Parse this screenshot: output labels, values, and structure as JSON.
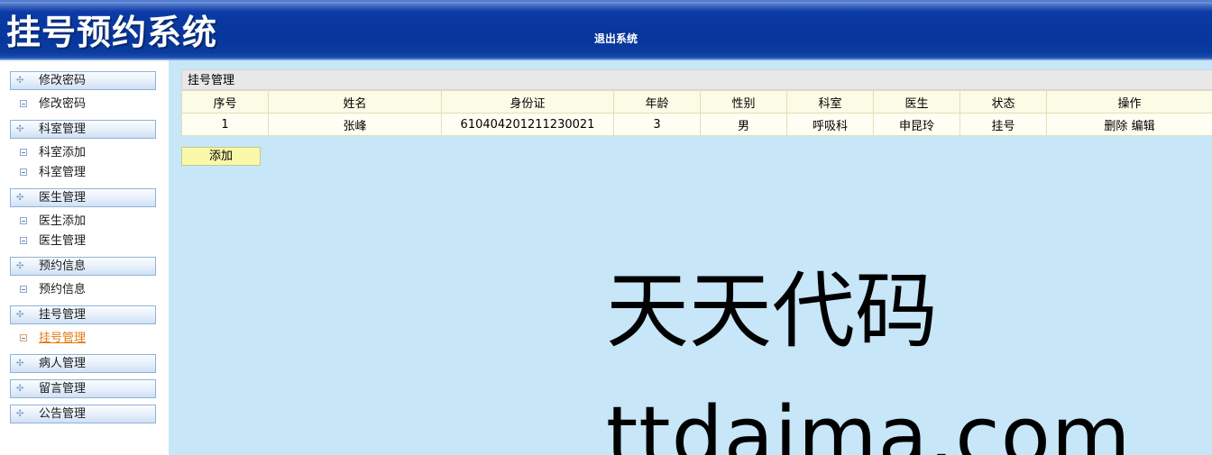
{
  "header": {
    "logo_text": "挂号预约系统",
    "logout_label": "退出系统"
  },
  "sidebar": {
    "groups": [
      {
        "title": "修改密码",
        "items": [
          "修改密码"
        ]
      },
      {
        "title": "科室管理",
        "items": [
          "科室添加",
          "科室管理"
        ]
      },
      {
        "title": "医生管理",
        "items": [
          "医生添加",
          "医生管理"
        ]
      },
      {
        "title": "预约信息",
        "items": [
          "预约信息"
        ]
      },
      {
        "title": "挂号管理",
        "items": [
          "挂号管理"
        ]
      },
      {
        "title": "病人管理",
        "items": []
      },
      {
        "title": "留言管理",
        "items": []
      },
      {
        "title": "公告管理",
        "items": []
      }
    ],
    "active_item": "挂号管理"
  },
  "panel": {
    "title": "挂号管理",
    "columns": [
      "序号",
      "姓名",
      "身份证",
      "年龄",
      "性别",
      "科室",
      "医生",
      "状态",
      "操作"
    ],
    "rows": [
      {
        "index": "1",
        "name": "张峰",
        "id_card": "610404201211230021",
        "age": "3",
        "gender": "男",
        "department": "呼吸科",
        "doctor": "申昆玲",
        "status": "挂号",
        "delete_label": "删除",
        "edit_label": "编辑"
      }
    ],
    "add_label": "添加"
  },
  "watermark": {
    "line1": "天天代码",
    "line2": "ttdaima.com"
  }
}
